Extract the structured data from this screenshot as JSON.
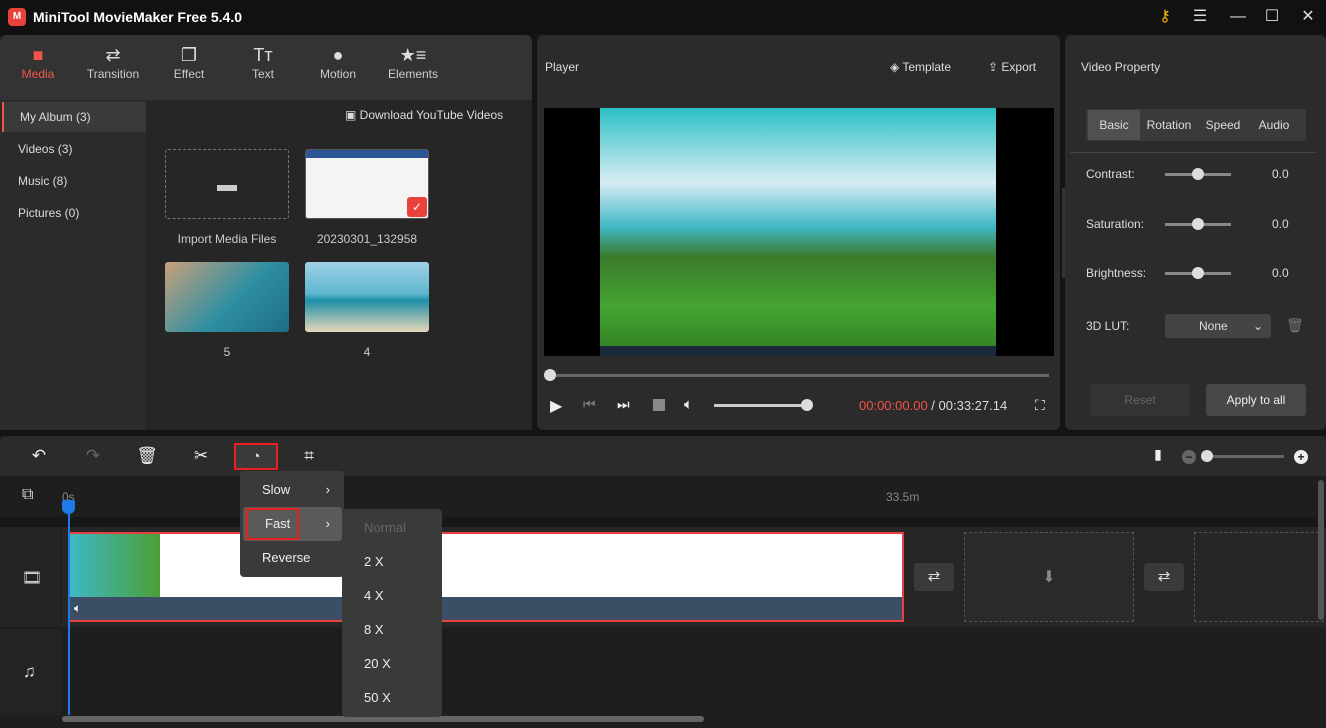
{
  "app": {
    "title": "MiniTool MovieMaker Free 5.4.0",
    "logo_text": "MiniTool"
  },
  "window": {
    "key_icon": "key-icon",
    "menu": "☰",
    "minimize": "—",
    "maximize": "☐",
    "close": "✕"
  },
  "nav": [
    {
      "label": "Media",
      "icon": "folder-icon",
      "active": true
    },
    {
      "label": "Transition",
      "icon": "arrows-icon"
    },
    {
      "label": "Effect",
      "icon": "layers-icon"
    },
    {
      "label": "Text",
      "icon": "text-icon"
    },
    {
      "label": "Motion",
      "icon": "motion-icon"
    },
    {
      "label": "Elements",
      "icon": "elements-icon"
    }
  ],
  "sidebar": [
    {
      "label": "My Album (3)",
      "active": true
    },
    {
      "label": "Videos (3)"
    },
    {
      "label": "Music (8)"
    },
    {
      "label": "Pictures (0)"
    }
  ],
  "media": {
    "download": "Download YouTube Videos",
    "items": [
      {
        "label": "Import Media Files"
      },
      {
        "label": "20230301_132958"
      },
      {
        "label": "5"
      },
      {
        "label": "4"
      }
    ]
  },
  "player": {
    "title": "Player",
    "template": "Template",
    "export": "Export",
    "current_time": "00:00:00.00",
    "separator": " / ",
    "total_time": "00:33:27.14",
    "volume": 0.85,
    "progress": 0
  },
  "property": {
    "title": "Video Property",
    "tabs": [
      "Basic",
      "Rotation",
      "Speed",
      "Audio"
    ],
    "active_tab": "Basic",
    "contrast": {
      "label": "Contrast:",
      "value": "0.0"
    },
    "saturation": {
      "label": "Saturation:",
      "value": "0.0"
    },
    "brightness": {
      "label": "Brightness:",
      "value": "0.0"
    },
    "lut": {
      "label": "3D LUT:",
      "value": "None"
    },
    "reset": "Reset",
    "apply_all": "Apply to all"
  },
  "timeline": {
    "ruler_start": "0s",
    "ruler_mark": "33.5m"
  },
  "speed_menu": {
    "items": [
      "Slow",
      "Fast",
      "Reverse"
    ],
    "active": "Fast"
  },
  "fast_submenu": {
    "items": [
      "Normal",
      "2 X",
      "4 X",
      "8 X",
      "20 X",
      "50 X"
    ],
    "disabled": "Normal"
  },
  "colors": {
    "accent": "#f0554a",
    "highlight": "#e82020",
    "time_current": "#f0554a",
    "playhead": "#1e7be6"
  }
}
